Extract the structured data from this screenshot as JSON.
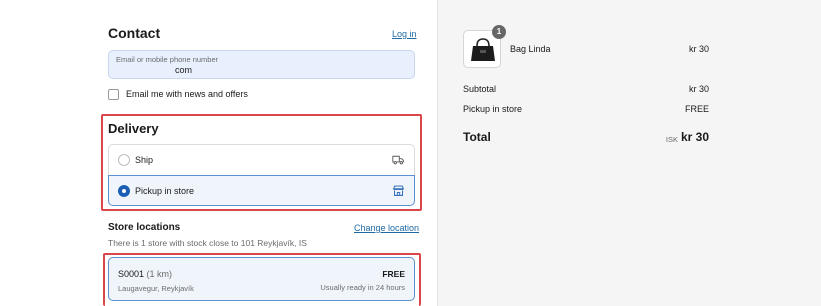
{
  "contact": {
    "heading": "Contact",
    "login_link": "Log in",
    "email_label": "Email or mobile phone number",
    "email_value": "com",
    "newsletter_label": "Email me with news and offers",
    "newsletter_checked": false
  },
  "delivery": {
    "heading": "Delivery",
    "options": [
      {
        "label": "Ship",
        "icon": "truck-icon",
        "selected": false
      },
      {
        "label": "Pickup in store",
        "icon": "store-icon",
        "selected": true
      }
    ]
  },
  "stores": {
    "heading": "Store locations",
    "change_link": "Change location",
    "subtitle": "There is 1 store with stock close to 101 Reykjavík, IS",
    "items": [
      {
        "id": "S0001",
        "distance": "(1 km)",
        "address": "Laugavegur, Reykjavík",
        "price": "FREE",
        "ready": "Usually ready in 24 hours"
      }
    ]
  },
  "summary": {
    "item": {
      "name": "Bag Linda",
      "price": "kr 30",
      "quantity": "1",
      "image_icon": "handbag-icon"
    },
    "subtotal_label": "Subtotal",
    "subtotal_value": "kr 30",
    "pickup_label": "Pickup in store",
    "pickup_value": "FREE",
    "total_label": "Total",
    "total_currency": "ISK",
    "total_value": "kr 30"
  },
  "colors": {
    "highlight_border": "#d9474b",
    "accent": "#1a5fb4",
    "link": "#1f6aa5"
  }
}
